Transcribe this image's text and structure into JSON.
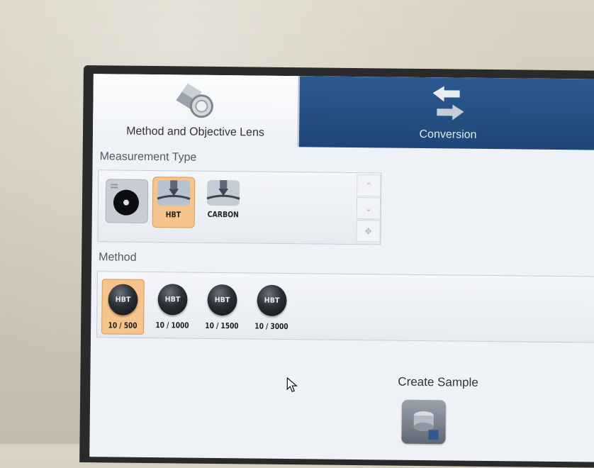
{
  "tabs": [
    {
      "label": "Method and Objective Lens",
      "icon": "lens-icon",
      "active": true
    },
    {
      "label": "Conversion",
      "icon": "arrows-exchange-icon",
      "active": false
    }
  ],
  "measurement_type": {
    "label": "Measurement Type",
    "items": [
      {
        "label": "",
        "icon": "optical-lens-icon",
        "selected": false
      },
      {
        "label": "HBT",
        "icon": "indenter-icon",
        "selected": true
      },
      {
        "label": "CARBON",
        "icon": "indenter-icon",
        "selected": false
      }
    ]
  },
  "method": {
    "label": "Method",
    "items": [
      {
        "badge": "HBT",
        "label": "10 / 500",
        "selected": true
      },
      {
        "badge": "HBT",
        "label": "10 / 1000",
        "selected": false
      },
      {
        "badge": "HBT",
        "label": "10 / 1500",
        "selected": false
      },
      {
        "badge": "HBT",
        "label": "10 / 3000",
        "selected": false
      }
    ]
  },
  "create_sample": {
    "label": "Create Sample",
    "icon": "sample-save-icon"
  },
  "colors": {
    "accent_selected": "#f6c48a",
    "tab_inactive": "#2c5b91"
  }
}
